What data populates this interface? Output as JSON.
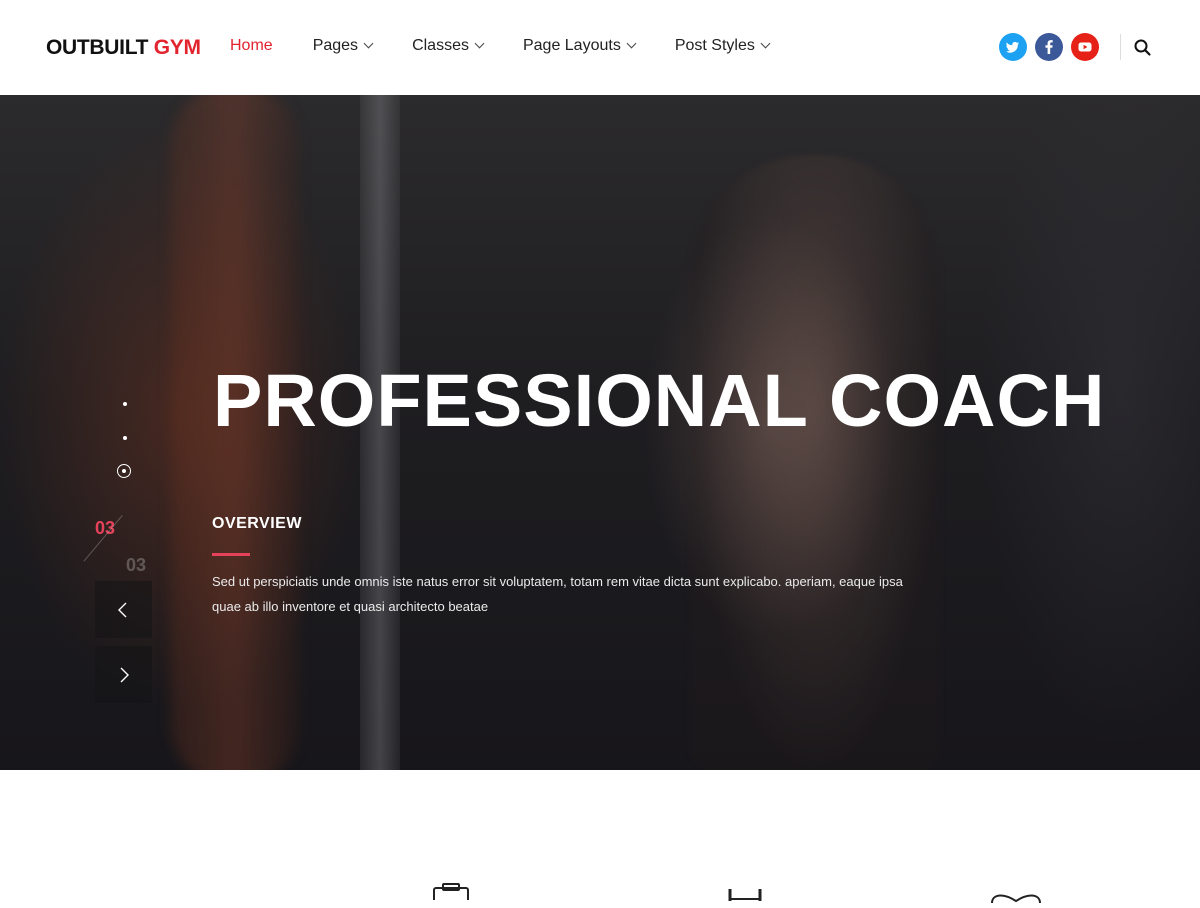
{
  "header": {
    "logo_main": "OUTBUILT",
    "logo_accent": "GYM",
    "nav": [
      {
        "label": "Home",
        "active": true
      },
      {
        "label": "Pages"
      },
      {
        "label": "Classes"
      },
      {
        "label": "Page Layouts"
      },
      {
        "label": "Post Styles"
      }
    ],
    "social_icons": [
      "twitter-icon",
      "facebook-icon",
      "youtube-icon"
    ],
    "search_icon": "search-icon"
  },
  "hero": {
    "title": "PROFESSIONAL COACH",
    "overview_label": "OVERVIEW",
    "overview_text": "Sed ut perspiciatis unde omnis iste natus error sit voluptatem, totam rem     vitae dicta sunt explicabo. aperiam, eaque ipsa quae ab illo inventore et quasi architecto beatae",
    "slide_current": "03",
    "slide_total": "03"
  },
  "colors": {
    "accent": "#e2242e",
    "pink_accent": "#e5425a",
    "twitter": "#1da1f2",
    "facebook": "#3b5998",
    "youtube": "#e62117"
  }
}
